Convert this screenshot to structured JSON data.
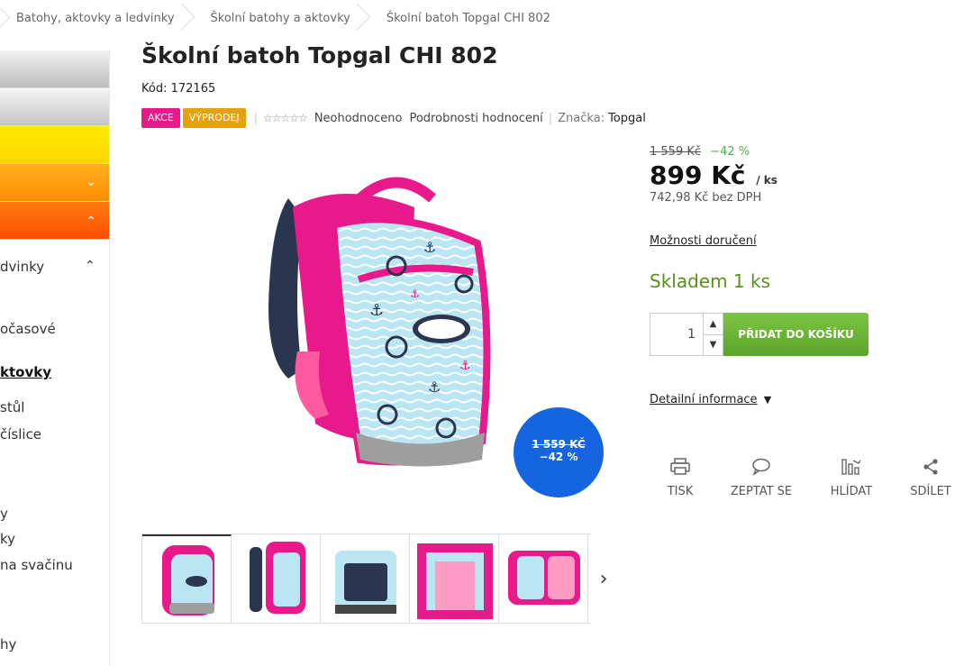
{
  "breadcrumb": {
    "items": [
      "Batohy, aktovky a ledvinky",
      "Školní batohy a aktovky",
      "Školní batoh Topgal CHI 802"
    ]
  },
  "sidebar": {
    "chevron_down": "⌄",
    "chevron_up": "⌃",
    "items": [
      "dvinky",
      "očasové",
      "ktovky",
      "stůl",
      "číslice",
      "y",
      "ky",
      "na svačinu",
      "hy"
    ]
  },
  "product": {
    "title": "Školní batoh Topgal CHI 802",
    "code_label": "Kód:",
    "code_value": "172165",
    "flags": [
      "AKCE",
      "VÝPRODEJ"
    ],
    "rating_text": "Neohodnoceno",
    "rating_link": "Podrobnosti hodnocení",
    "brand_label": "Značka:",
    "brand_value": "Topgal",
    "badge_old_price": "1 559 KČ",
    "badge_discount": "−42 %"
  },
  "purchase": {
    "old_price": "1 559 Kč",
    "discount": "−42 %",
    "price": "899 Kč",
    "price_unit": "/ ks",
    "price_net": "742,98 Kč bez DPH",
    "delivery_link": "Možnosti doručení",
    "stock": "Skladem 1 ks",
    "quantity": "1",
    "add_to_cart": "PŘIDAT DO KOŠÍKU",
    "details_link": "Detailní informace"
  },
  "actions": [
    {
      "label": "TISK",
      "icon": "printer-icon"
    },
    {
      "label": "ZEPTAT SE",
      "icon": "chat-bubble-icon"
    },
    {
      "label": "HLÍDAT",
      "icon": "watch-chart-icon"
    },
    {
      "label": "SDÍLET",
      "icon": "share-icon"
    }
  ],
  "colors": {
    "akce": "#e8198b",
    "vyprodej": "#e5a10e",
    "stock_green": "#5a8f1c",
    "cart_green": "#6bb536",
    "badge_blue": "#1565e0"
  }
}
